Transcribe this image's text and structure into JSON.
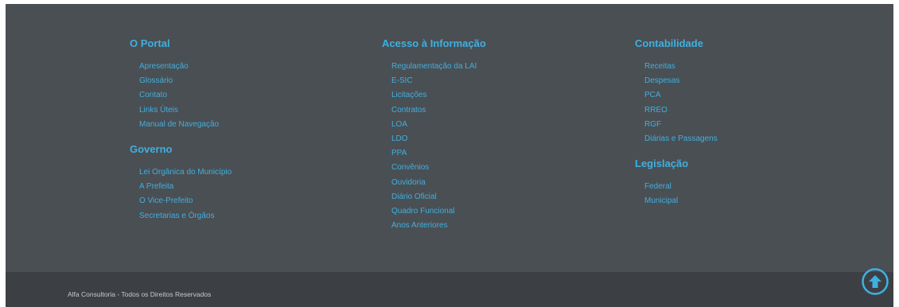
{
  "footer": {
    "columns": [
      {
        "sections": [
          {
            "title": "O Portal",
            "links": [
              "Apresentação",
              "Glossário",
              "Contato",
              "Links Úteis",
              "Manual de Navegação"
            ]
          },
          {
            "title": "Governo",
            "links": [
              "Lei Orgânica do Município",
              "A Prefeita",
              "O Vice-Prefeito",
              "Secretarias e Órgãos"
            ]
          }
        ]
      },
      {
        "sections": [
          {
            "title": "Acesso à Informação",
            "links": [
              "Regulamentação da LAI",
              "E-SIC",
              "Licitações",
              "Contratos",
              "LOA",
              "LDO",
              "PPA",
              "Convênios",
              "Ouvidoria",
              "Diário Oficial",
              "Quadro Funcional",
              "Anos Anteriores"
            ]
          }
        ]
      },
      {
        "sections": [
          {
            "title": "Contabilidade",
            "links": [
              "Receitas",
              "Despesas",
              "PCA",
              "RREO",
              "RGF",
              "Diárias e Passagens"
            ]
          },
          {
            "title": "Legislação",
            "links": [
              "Federal",
              "Municipal"
            ]
          }
        ]
      }
    ],
    "copyright": "Alfa Consultoria - Todos os Direitos Reservados",
    "back_to_top_icon": "arrow-up-circle-icon",
    "colors": {
      "background": "#4a4f54",
      "bottom_bar": "#3c4045",
      "accent": "#3fb0df"
    }
  }
}
